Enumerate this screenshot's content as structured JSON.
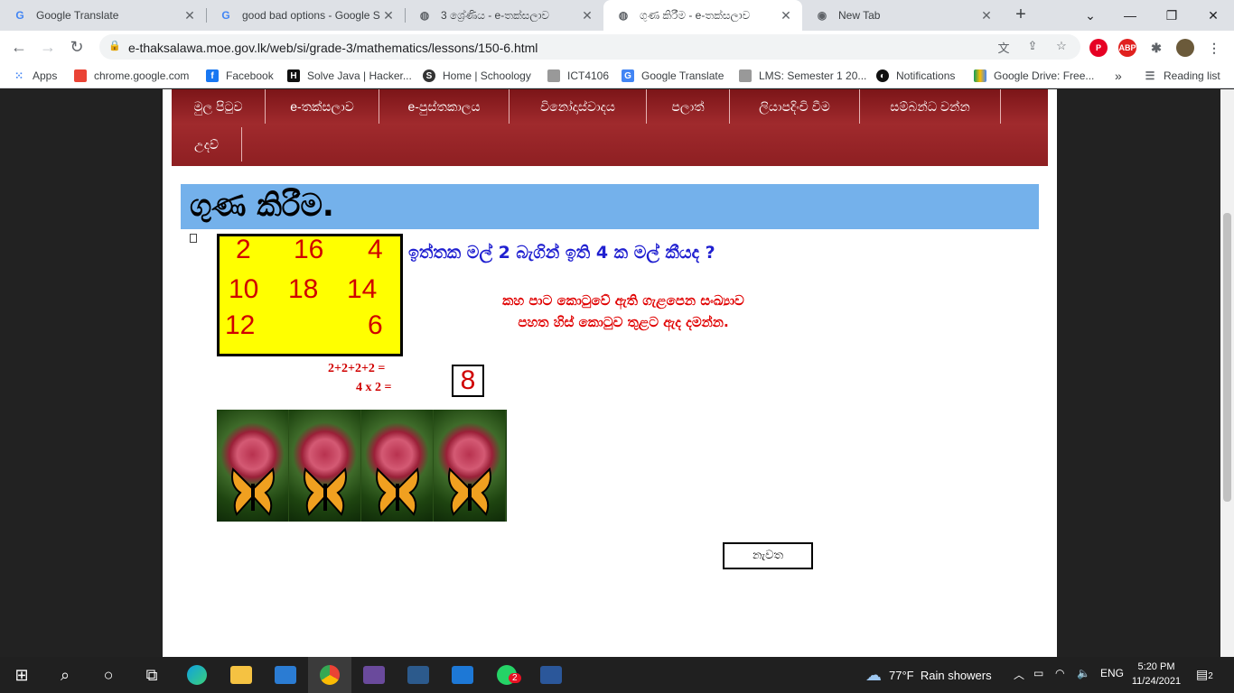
{
  "browser": {
    "tabs": [
      {
        "title": "Google Translate",
        "icon": "google-translate-icon",
        "active": false
      },
      {
        "title": "good bad options - Google S",
        "icon": "google-icon",
        "active": false
      },
      {
        "title": "3 ශ්‍රේණිය - e-තක්සලාව",
        "icon": "globe-icon",
        "active": false
      },
      {
        "title": "ගුණ කිරීම - e-තක්සලාව",
        "icon": "globe-icon",
        "active": true
      },
      {
        "title": "New Tab",
        "icon": "chrome-icon",
        "active": false
      }
    ],
    "url": "e-thaksalawa.moe.gov.lk/web/si/grade-3/mathematics/lessons/150-6.html",
    "bookmarks": [
      {
        "label": "Apps",
        "icon": "apps-grid-icon"
      },
      {
        "label": "chrome.google.com",
        "icon": "page-icon"
      },
      {
        "label": "Facebook",
        "icon": "facebook-icon"
      },
      {
        "label": "Solve Java | Hacker...",
        "icon": "hackerrank-icon"
      },
      {
        "label": "Home | Schoology",
        "icon": "schoology-icon"
      },
      {
        "label": "ICT4106",
        "icon": "page-icon"
      },
      {
        "label": "Google Translate",
        "icon": "google-translate-icon"
      },
      {
        "label": "LMS: Semester 1 20...",
        "icon": "page-icon"
      },
      {
        "label": "Notifications",
        "icon": "github-icon"
      },
      {
        "label": "Google Drive: Free...",
        "icon": "google-drive-icon"
      }
    ],
    "more_bookmarks": "»",
    "reading_list": "Reading list"
  },
  "site": {
    "nav": [
      "මුල පිටුව",
      "e-තක්සලාව",
      "e-පුස්තකාලය",
      "විනෝදාස්වාදය",
      "පලාත්",
      "ලියාපදිංචි වීම",
      "සම්බන්ධ වන්න",
      "උදව්"
    ],
    "title": "ගුණ කිරීම.",
    "grid_numbers": [
      "2",
      "16",
      "4",
      "10",
      "18",
      "14",
      "12",
      "6"
    ],
    "question": "ඉත්තක මල් 2 බැගින් ඉති 4 ක මල් කීයද ?",
    "instruction_line1": "කහ පාට කොටුවේ ඇති ගැළපෙන සංඛ්‍යාව",
    "instruction_line2": "පහත හිස් කොටුව තුළට ඇද දමන්න.",
    "sum_line1": "2+2+2+2 =",
    "sum_line2": "4 x 2 =",
    "answer": "8",
    "again_button": "නැවත"
  },
  "taskbar": {
    "weather_temp": "77°F",
    "weather_text": "Rain showers",
    "language": "ENG",
    "time": "5:20 PM",
    "date": "11/24/2021",
    "notification_count": "2",
    "whatsapp_badge": "2"
  }
}
